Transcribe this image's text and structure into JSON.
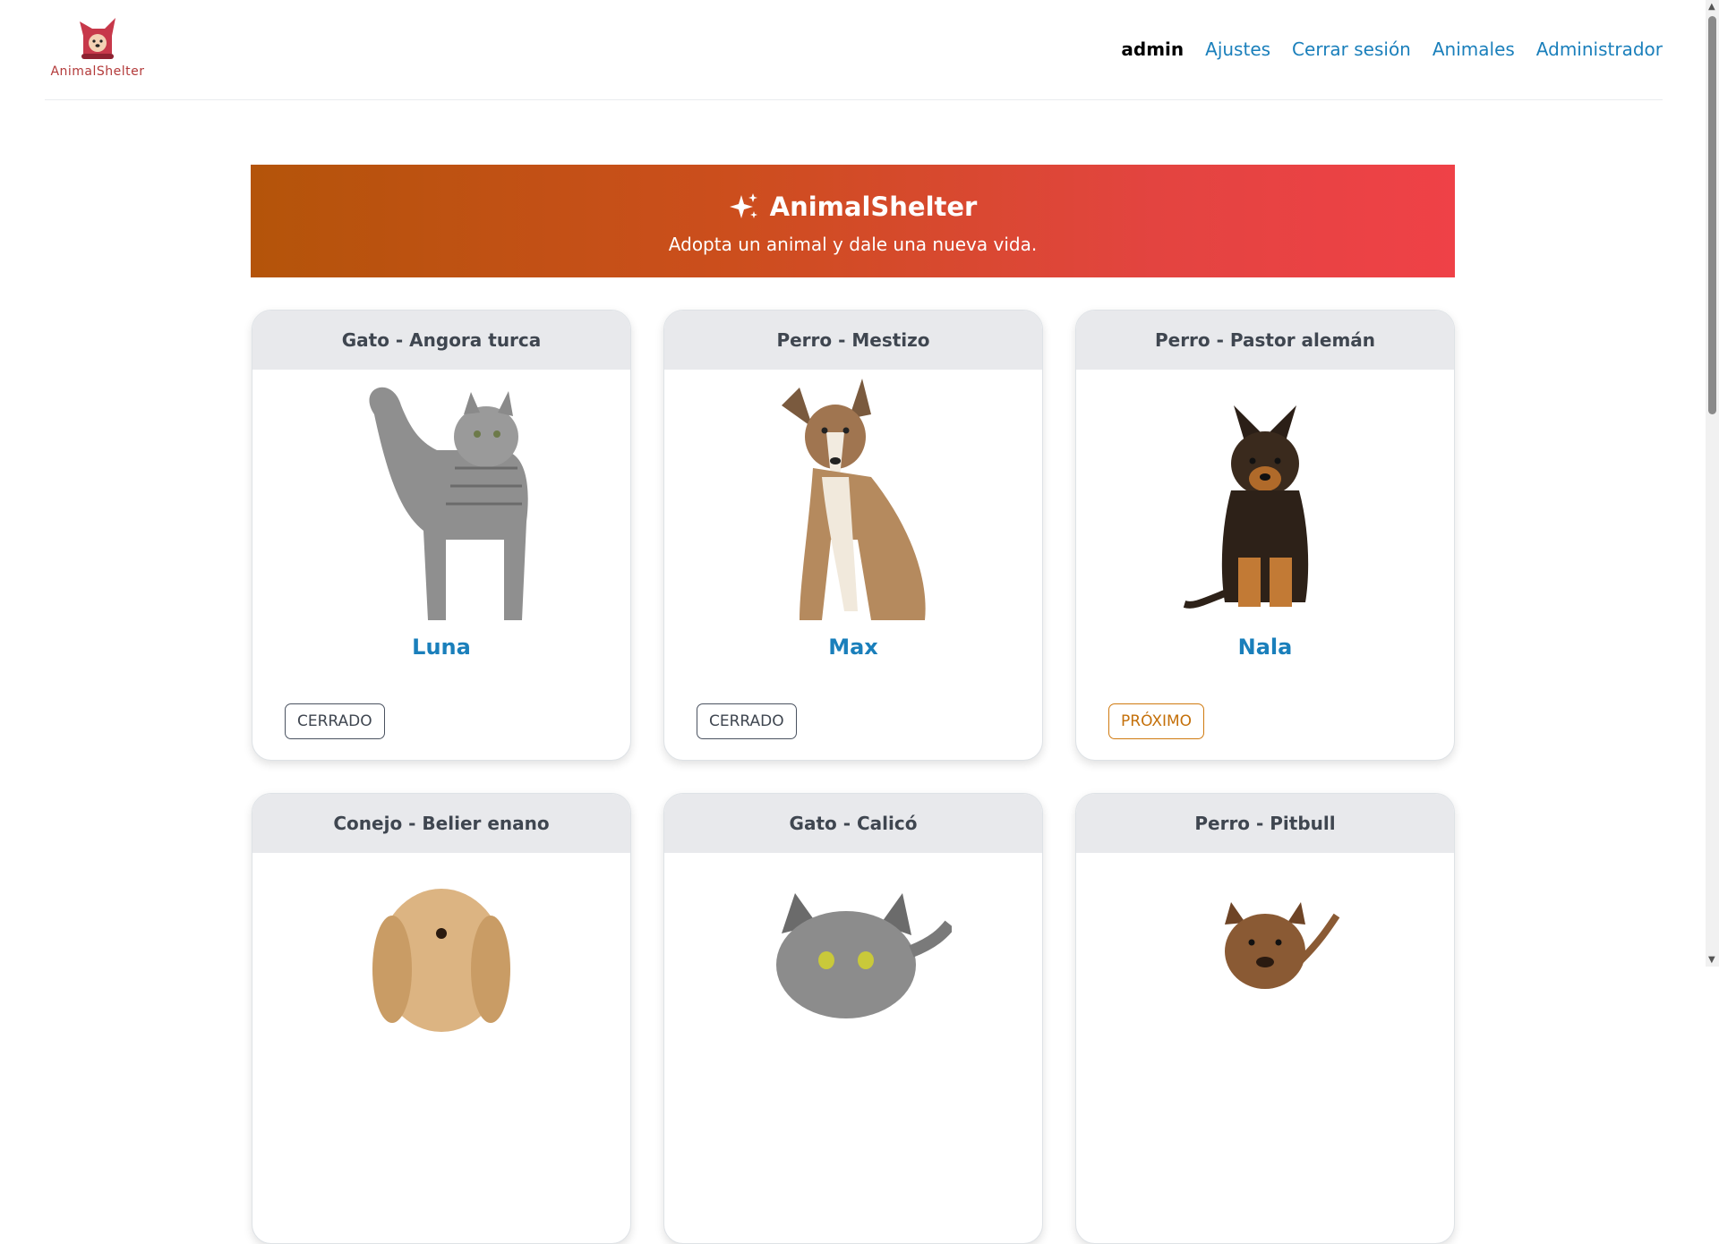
{
  "header": {
    "logo_text": "AnimalShelter",
    "nav": {
      "user": "admin",
      "settings": "Ajustes",
      "logout": "Cerrar sesión",
      "animals": "Animales",
      "admin": "Administrador"
    }
  },
  "hero": {
    "icon": "sparkles-icon",
    "title": "AnimalShelter",
    "subtitle": "Adopta un animal y dale una nueva vida."
  },
  "cards": [
    {
      "header": "Gato - Angora turca",
      "name": "Luna",
      "status": "CERRADO",
      "image": "gray-cat-photo"
    },
    {
      "header": "Perro - Mestizo",
      "name": "Max",
      "status": "CERRADO",
      "image": "mixed-breed-dog-photo"
    },
    {
      "header": "Perro - Pastor alemán",
      "name": "Nala",
      "status": "PRÓXIMO",
      "image": "german-shepherd-puppy-photo"
    },
    {
      "header": "Conejo - Belier enano",
      "name": "",
      "status": "",
      "image": "lop-rabbit-photo"
    },
    {
      "header": "Gato - Calicó",
      "name": "",
      "status": "",
      "image": "calico-cat-photo"
    },
    {
      "header": "Perro - Pitbull",
      "name": "",
      "status": "",
      "image": "pitbull-dog-photo"
    }
  ],
  "colors": {
    "link": "#1a7fbb",
    "hero_start": "#b4540a",
    "hero_end": "#ef4147",
    "badge_upcoming": "#c4700a"
  }
}
